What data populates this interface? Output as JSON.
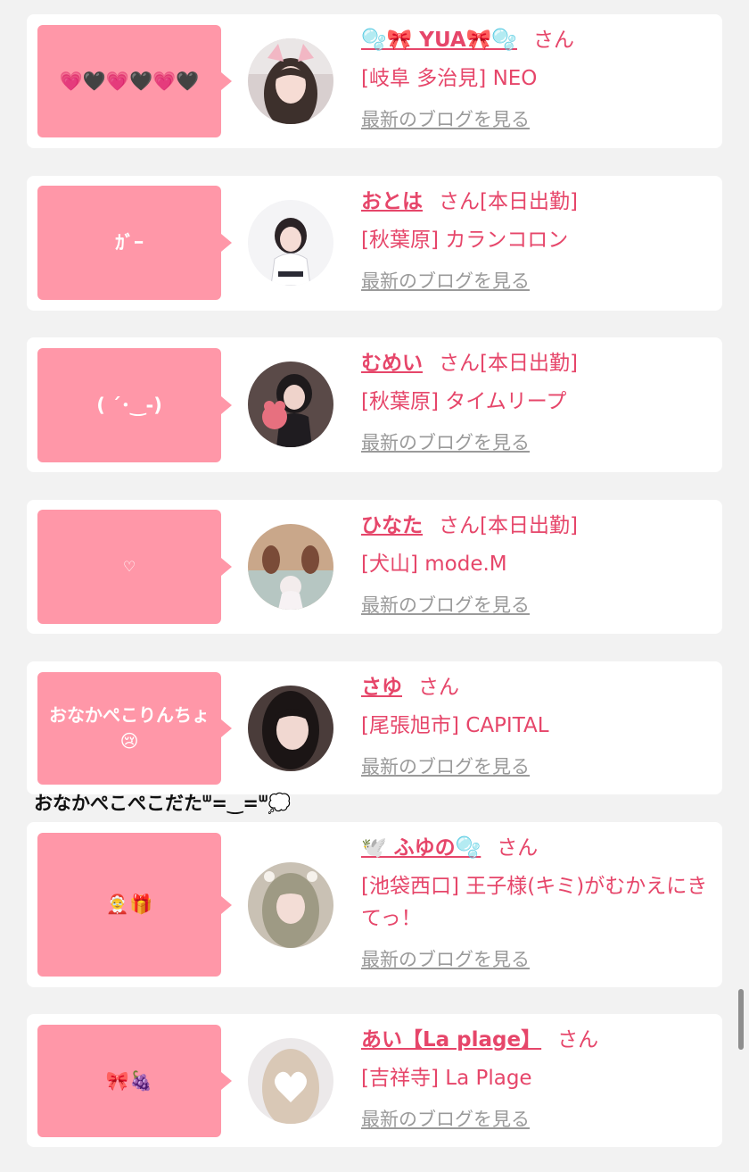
{
  "link_color": "#e6466a",
  "bubble_color": "#ff97a8",
  "entries": [
    {
      "name": "🫧🎀 YUA🎀🫧",
      "honorific": "さん",
      "status": "",
      "shop": "[岐阜 多治見] NEO",
      "blog_link": "最新のブログを見る",
      "bubble": "💗🖤💗🖤💗🖤"
    },
    {
      "name": "おとは",
      "honorific": "さん",
      "status": "[本日出勤]",
      "shop": "[秋葉原] カランコロン",
      "blog_link": "最新のブログを見る",
      "bubble": "ｶﾞｰ"
    },
    {
      "name": "むめい",
      "honorific": "さん",
      "status": "[本日出勤]",
      "shop": "[秋葉原] タイムリープ",
      "blog_link": "最新のブログを見る",
      "bubble": "( ´･‿-)"
    },
    {
      "name": "ひなた",
      "honorific": "さん",
      "status": "[本日出勤]",
      "shop": "[犬山] mode.M",
      "blog_link": "最新のブログを見る",
      "bubble": "♡"
    },
    {
      "name": "さゆ",
      "honorific": "さん",
      "status": "",
      "shop": "[尾張旭市] CAPITAL",
      "blog_link": "最新のブログを見る",
      "bubble": "おなかぺこりんちょ😢"
    },
    {
      "name": "🕊️ ふゆの🫧",
      "honorific": "さん",
      "status": "",
      "shop": "[池袋西口] 王子様(キミ)がむかえにきてっ！",
      "blog_link": "最新のブログを見る",
      "bubble": "🤶🎁"
    },
    {
      "name": "あい【La plage】",
      "honorific": "さん",
      "status": "",
      "shop": "[吉祥寺] La Plage",
      "blog_link": "最新のブログを見る",
      "bubble": "🎀🍇"
    }
  ],
  "interlude_text": "おなかぺこぺこだたᐜ=‿=ᐜ💭"
}
